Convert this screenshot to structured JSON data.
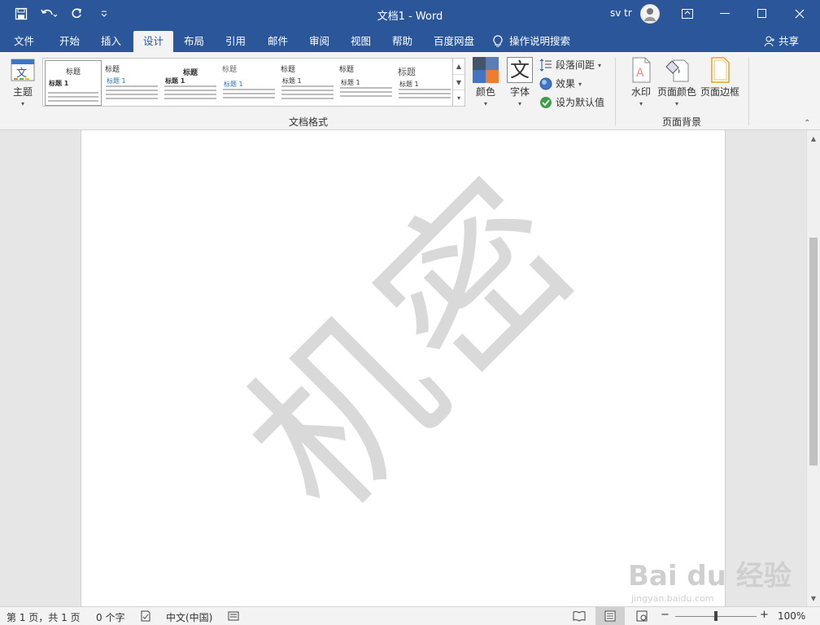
{
  "titlebar": {
    "document_title": "文档1  -  Word",
    "user_name": "sv tr",
    "qat": {
      "save_icon": "save-icon",
      "undo_icon": "undo-icon",
      "redo_icon": "redo-icon",
      "customize_icon": "chevron-down-icon"
    },
    "window_buttons": {
      "ribbon_display": "▣",
      "minimize": "—",
      "maximize": "☐",
      "close": "✕"
    }
  },
  "tabs": [
    "文件",
    "开始",
    "插入",
    "设计",
    "布局",
    "引用",
    "邮件",
    "审阅",
    "视图",
    "帮助",
    "百度网盘"
  ],
  "active_tab": "设计",
  "tell_me": "操作说明搜索",
  "share": "共享",
  "ribbon": {
    "theme_label": "主题",
    "gallery_styles": [
      {
        "heading": "标题",
        "sub": "标题 1"
      },
      {
        "heading": "标题",
        "sub": "标题 1"
      },
      {
        "heading": "标题",
        "sub": "标题 1"
      },
      {
        "heading": "标题",
        "sub": "标题 1"
      },
      {
        "heading": "标题",
        "sub": "标题 1"
      },
      {
        "heading": "标题",
        "sub": "标题 1"
      },
      {
        "heading": "标题",
        "sub": "标题 1"
      }
    ],
    "colors_label": "颜色",
    "fonts_label": "字体",
    "fonts_glyph": "文",
    "paragraph_spacing": "段落间距",
    "effects": "效果",
    "set_default": "设为默认值",
    "group_document_format": "文档格式",
    "watermark_label": "水印",
    "page_color_label": "页面颜色",
    "page_border_label": "页面边框",
    "group_page_background": "页面背景"
  },
  "document": {
    "watermark_text": "机密"
  },
  "baidu_logo": {
    "big": "Bai du 经验",
    "small": "jingyan.baidu.com"
  },
  "statusbar": {
    "page": "第 1 页，共 1 页",
    "words": "0 个字",
    "language": "中文(中国)",
    "zoom_minus": "−",
    "zoom_plus": "+",
    "zoom": "100%"
  },
  "colors": {
    "accent": "#2b579a",
    "ribbon_bg": "#f3f3f3"
  }
}
